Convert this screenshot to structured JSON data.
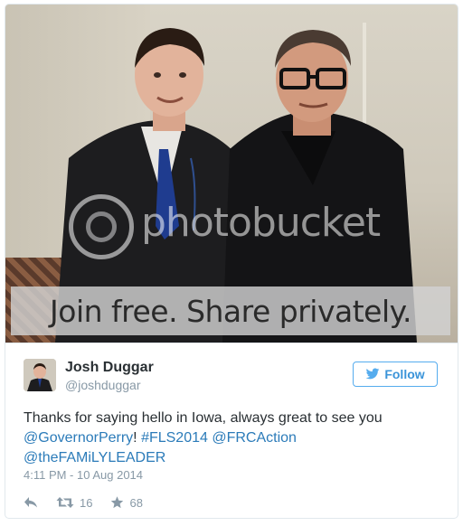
{
  "photo": {
    "watermark_brand": "photobucket",
    "banner_text": "Join free. Share privately."
  },
  "user": {
    "name": "Josh Duggar",
    "handle": "@joshduggar"
  },
  "follow_label": "Follow",
  "tweet": {
    "text_plain_1": "Thanks for saying hello in Iowa, always great to see you ",
    "mention_perry": "@GovernorPerry",
    "text_plain_2": "! ",
    "hashtag": "#FLS2014",
    "text_plain_3": " ",
    "mention_frc": "@FRCAction",
    "text_plain_4": " ",
    "mention_family": "@theFAMiLYLEADER",
    "timestamp": "4:11 PM - 10 Aug 2014"
  },
  "actions": {
    "reply_icon": "reply-icon",
    "retweet_icon": "retweet-icon",
    "retweet_count": "16",
    "favorite_icon": "star-icon",
    "favorite_count": "68"
  },
  "colors": {
    "link": "#2b7bb9",
    "follow": "#55acee",
    "muted": "#8899a6",
    "text": "#292f33"
  }
}
